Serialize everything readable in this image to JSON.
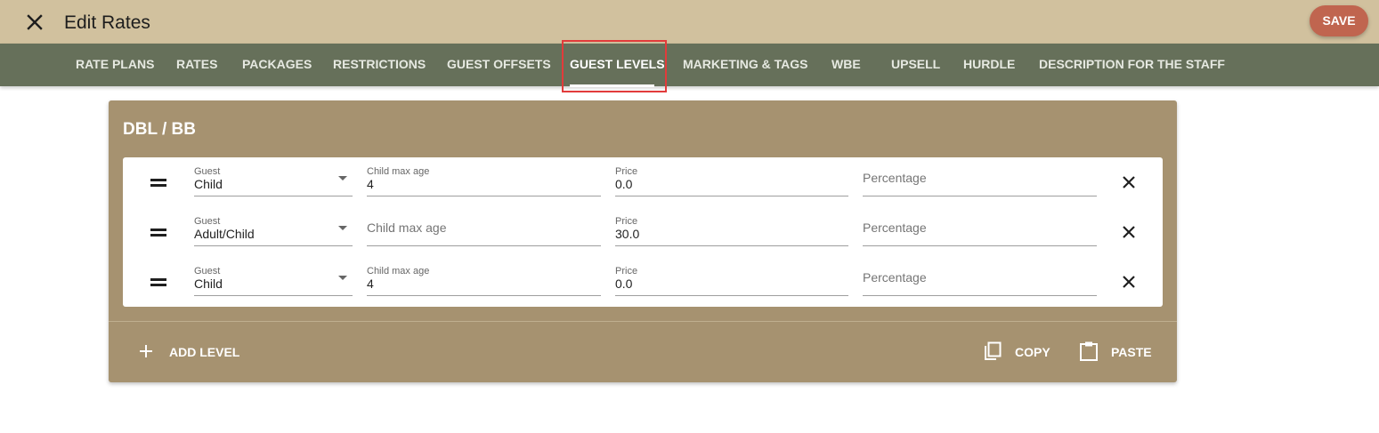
{
  "header": {
    "title": "Edit Rates",
    "save_label": "SAVE"
  },
  "tabs": [
    {
      "label": "RATE PLANS"
    },
    {
      "label": "RATES"
    },
    {
      "label": "PACKAGES"
    },
    {
      "label": "RESTRICTIONS"
    },
    {
      "label": "GUEST OFFSETS"
    },
    {
      "label": "GUEST LEVELS",
      "active": true
    },
    {
      "label": "MARKETING & TAGS"
    },
    {
      "label": "WBE"
    },
    {
      "label": "UPSELL"
    },
    {
      "label": "HURDLE"
    },
    {
      "label": "DESCRIPTION FOR THE STAFF"
    }
  ],
  "card": {
    "title": "DBL / BB",
    "rows": [
      {
        "guest_label": "Guest",
        "guest_value": "Child",
        "age_label": "Child max age",
        "age_value": "4",
        "price_label": "Price",
        "price_value": "0.0",
        "percentage_placeholder": "Percentage"
      },
      {
        "guest_label": "Guest",
        "guest_value": "Adult/Child",
        "age_placeholder": "Child max age",
        "price_label": "Price",
        "price_value": "30.0",
        "percentage_placeholder": "Percentage"
      },
      {
        "guest_label": "Guest",
        "guest_value": "Child",
        "age_label": "Child max age",
        "age_value": "4",
        "price_label": "Price",
        "price_value": "0.0",
        "percentage_placeholder": "Percentage"
      }
    ],
    "actions": {
      "add_level": "ADD LEVEL",
      "copy": "COPY",
      "paste": "PASTE"
    }
  },
  "colors": {
    "header_bg": "#d1c19e",
    "tabs_bg": "#66705a",
    "card_bg": "#a69270",
    "save_bg": "#c0654f",
    "highlight": "#e23b3b"
  },
  "icons": {
    "close": "close-icon",
    "drag": "drag-handle-icon",
    "delete": "delete-x-icon",
    "add": "plus-icon",
    "copy": "copy-icon",
    "paste": "clipboard-icon",
    "dropdown": "caret-down-icon"
  }
}
